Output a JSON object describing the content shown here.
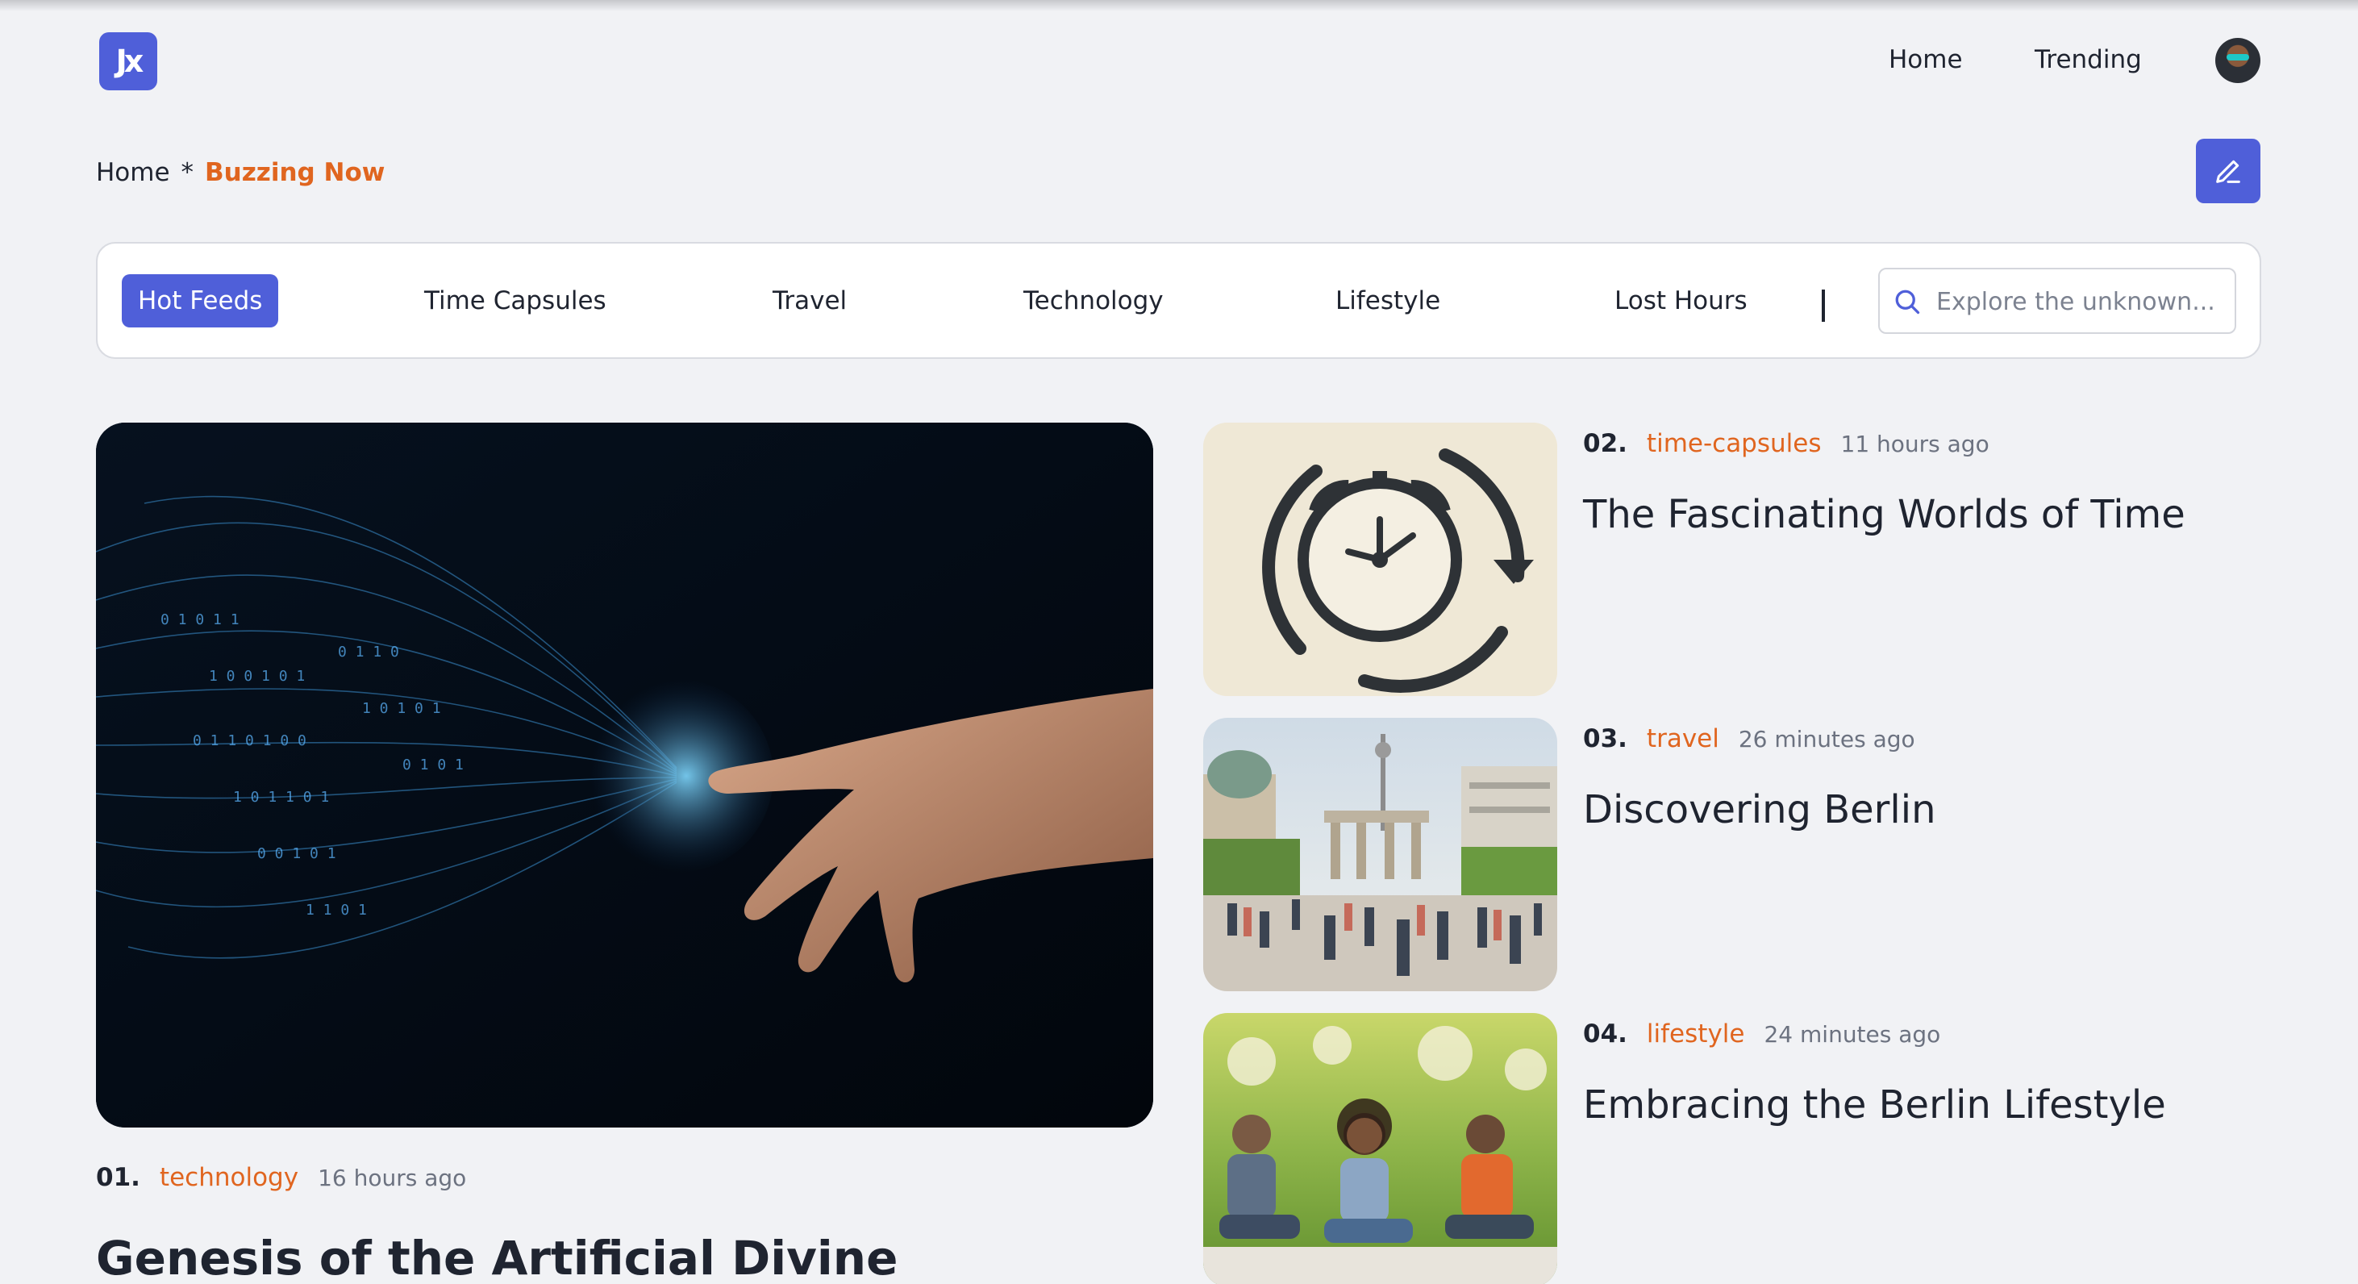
{
  "header": {
    "logo_text": "Jx",
    "nav": [
      {
        "label": "Home"
      },
      {
        "label": "Trending"
      }
    ]
  },
  "breadcrumb": {
    "home": "Home",
    "separator": "*",
    "current": "Buzzing Now"
  },
  "categories": [
    {
      "label": "Hot Feeds",
      "active": true
    },
    {
      "label": "Time Capsules"
    },
    {
      "label": "Travel"
    },
    {
      "label": "Technology"
    },
    {
      "label": "Lifestyle"
    },
    {
      "label": "Lost Hours"
    }
  ],
  "search": {
    "placeholder": "Explore the unknown..."
  },
  "featured": {
    "number": "01.",
    "category": "technology",
    "time": "16 hours ago",
    "title": "Genesis of the Artificial Divine"
  },
  "posts": [
    {
      "number": "02.",
      "category": "time-capsules",
      "time": "11 hours ago",
      "title": "The Fascinating Worlds of Time"
    },
    {
      "number": "03.",
      "category": "travel",
      "time": "26 minutes ago",
      "title": "Discovering Berlin"
    },
    {
      "number": "04.",
      "category": "lifestyle",
      "time": "24 minutes ago",
      "title": "Embracing the Berlin Lifestyle"
    }
  ],
  "colors": {
    "accent": "#4f5fd9",
    "category": "#e0651f",
    "background": "#f1f2f5"
  }
}
